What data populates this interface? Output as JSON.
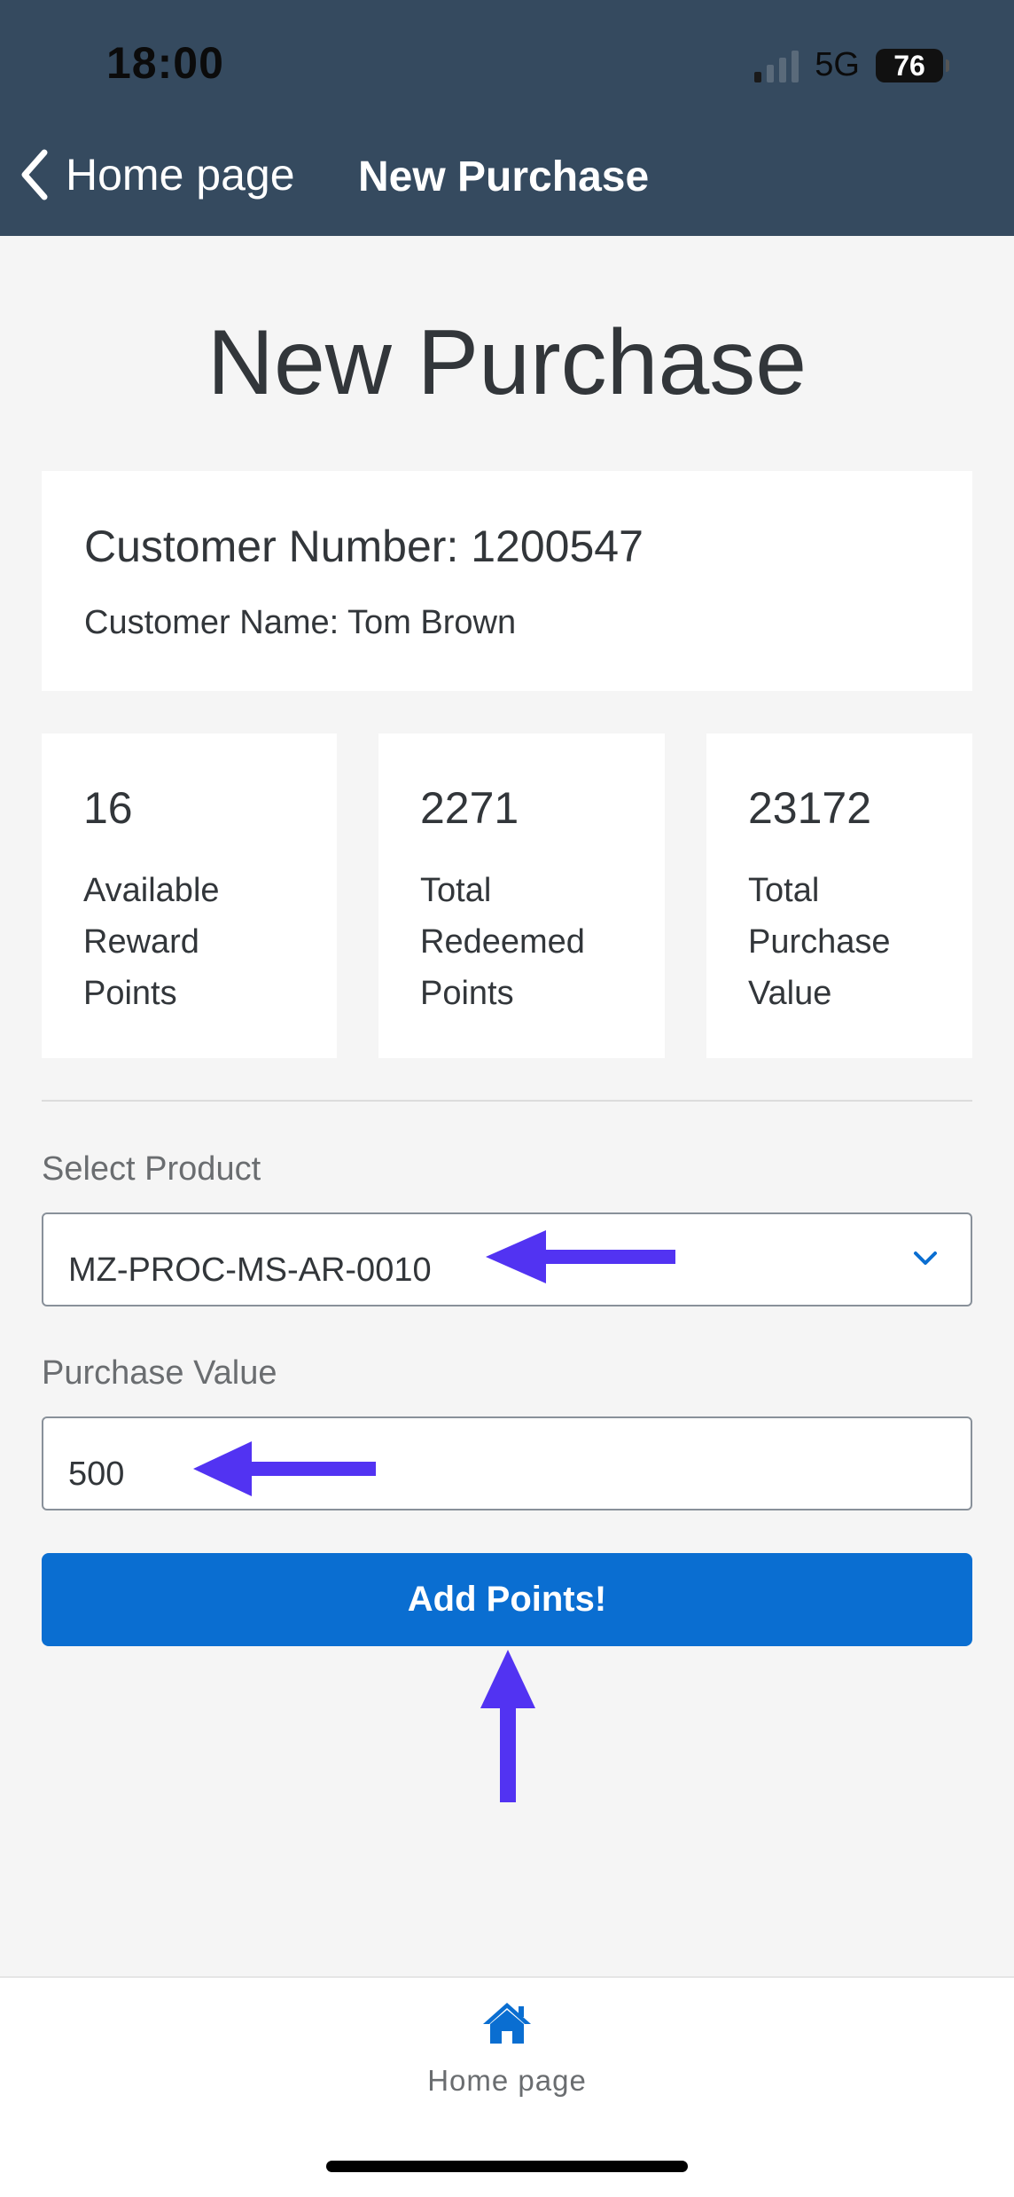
{
  "status_bar": {
    "time": "18:00",
    "network": "5G",
    "battery": "76"
  },
  "nav": {
    "back_label": "Home page",
    "title": "New Purchase"
  },
  "page": {
    "title": "New Purchase"
  },
  "customer": {
    "number_label": "Customer Number: 1200547",
    "name_label": "Customer Name: Tom Brown"
  },
  "stats": [
    {
      "value": "16",
      "label": "Available Reward Points"
    },
    {
      "value": "2271",
      "label": "Total Redeemed Points"
    },
    {
      "value": "23172",
      "label": "Total Purchase Value"
    }
  ],
  "form": {
    "product_label": "Select Product",
    "product_value": "MZ-PROC-MS-AR-0010",
    "purchase_label": "Purchase Value",
    "purchase_value": "500",
    "submit_label": "Add Points!"
  },
  "tabbar": {
    "home_label": "Home page"
  },
  "colors": {
    "header_bg": "#354a5f",
    "accent": "#0a6ed1",
    "annotation_arrow": "#5233f2",
    "page_bg": "#f5f5f5"
  },
  "icons": [
    "back-chevron-icon",
    "dropdown-chevron-icon",
    "home-icon",
    "signal-icon",
    "battery-icon"
  ]
}
